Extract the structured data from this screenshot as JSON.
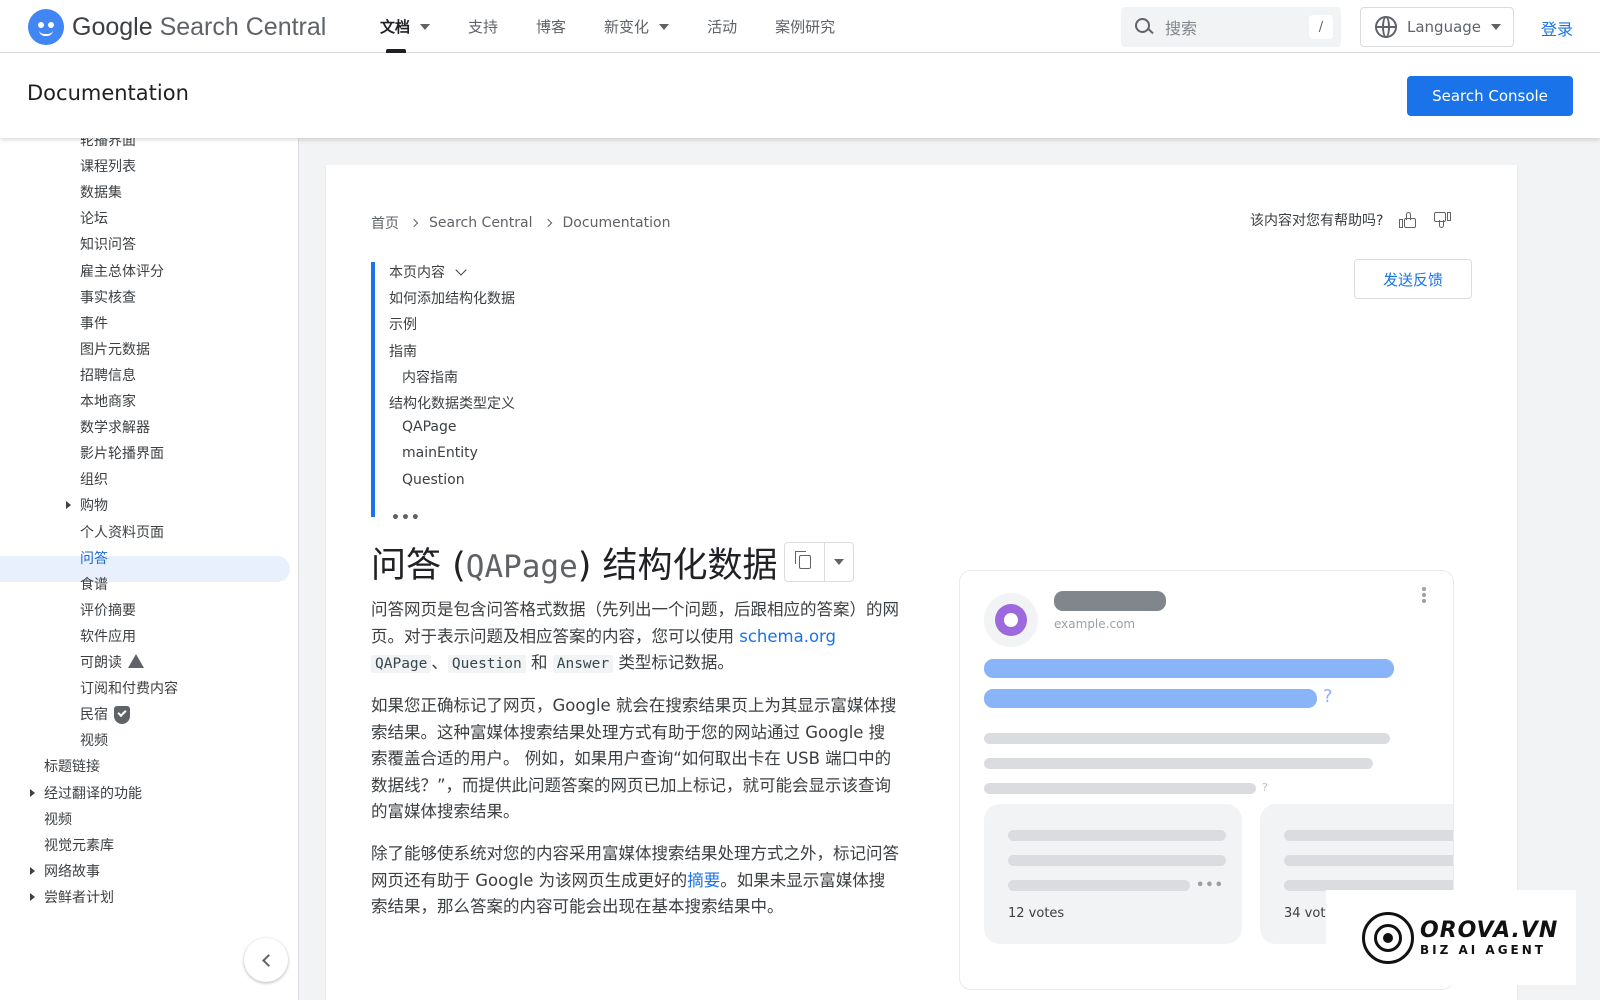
{
  "header": {
    "logo_text_brand": "Google",
    "logo_text_product": "Search Central",
    "nav": [
      {
        "label": "文档",
        "has_dropdown": true,
        "active": true
      },
      {
        "label": "支持",
        "has_dropdown": false
      },
      {
        "label": "博客",
        "has_dropdown": false
      },
      {
        "label": "新变化",
        "has_dropdown": true
      },
      {
        "label": "活动",
        "has_dropdown": false
      },
      {
        "label": "案例研究",
        "has_dropdown": false
      }
    ],
    "search_placeholder": "搜索",
    "search_shortcut": "/",
    "language_label": "Language",
    "login_label": "登录"
  },
  "subheader": {
    "title": "Documentation",
    "search_console_label": "Search Console"
  },
  "sidebar": {
    "items": [
      {
        "label": "轮播界面",
        "level": 2
      },
      {
        "label": "课程列表",
        "level": 2
      },
      {
        "label": "数据集",
        "level": 2
      },
      {
        "label": "论坛",
        "level": 2
      },
      {
        "label": "知识问答",
        "level": 2
      },
      {
        "label": "雇主总体评分",
        "level": 2
      },
      {
        "label": "事实核查",
        "level": 2
      },
      {
        "label": "事件",
        "level": 2
      },
      {
        "label": "图片元数据",
        "level": 2
      },
      {
        "label": "招聘信息",
        "level": 2
      },
      {
        "label": "本地商家",
        "level": 2
      },
      {
        "label": "数学求解器",
        "level": 2
      },
      {
        "label": "影片轮播界面",
        "level": 2
      },
      {
        "label": "组织",
        "level": 2
      },
      {
        "label": "购物",
        "level": 2,
        "expandable": true
      },
      {
        "label": "个人资料页面",
        "level": 2
      },
      {
        "label": "问答",
        "level": 2,
        "active": true
      },
      {
        "label": "食谱",
        "level": 2
      },
      {
        "label": "评价摘要",
        "level": 2
      },
      {
        "label": "软件应用",
        "level": 2
      },
      {
        "label": "可朗读",
        "level": 2,
        "icon": "flask-icon"
      },
      {
        "label": "订阅和付费内容",
        "level": 2
      },
      {
        "label": "民宿",
        "level": 2,
        "icon": "verified-shield-icon"
      },
      {
        "label": "视频",
        "level": 2
      },
      {
        "label": "标题链接",
        "level": 1
      },
      {
        "label": "经过翻译的功能",
        "level": 1,
        "expandable": true
      },
      {
        "label": "视频",
        "level": 1
      },
      {
        "label": "视觉元素库",
        "level": 1
      },
      {
        "label": "网络故事",
        "level": 1,
        "expandable": true
      },
      {
        "label": "尝鲜者计划",
        "level": 1,
        "expandable": true
      }
    ]
  },
  "breadcrumb": [
    "首页",
    "Search Central",
    "Documentation"
  ],
  "helpful_question": "该内容对您有帮助吗?",
  "feedback_label": "发送反馈",
  "toc": {
    "heading": "本页内容",
    "items": [
      {
        "label": "如何添加结构化数据",
        "indent": 0
      },
      {
        "label": "示例",
        "indent": 0
      },
      {
        "label": "指南",
        "indent": 0
      },
      {
        "label": "内容指南",
        "indent": 1
      },
      {
        "label": "结构化数据类型定义",
        "indent": 0
      },
      {
        "label": "QAPage",
        "indent": 1
      },
      {
        "label": "mainEntity",
        "indent": 1
      },
      {
        "label": "Question",
        "indent": 1
      }
    ],
    "more": "•••"
  },
  "article": {
    "title_prefix": "问答 (",
    "title_code": "QAPage",
    "title_suffix": ") 结构化数据",
    "p1_a": "问答网页是包含问答格式数据（先列出一个问题，后跟相应的答案）的网页。对于表示问题及相应答案的内容，您可以使用 ",
    "p1_link": "schema.org",
    "p1_code1": "QAPage",
    "p1_sep1": "、",
    "p1_code2": "Question",
    "p1_sep2": " 和 ",
    "p1_code3": "Answer",
    "p1_b": " 类型标记数据。",
    "p2": "如果您正确标记了网页，Google 就会在搜索结果页上为其显示富媒体搜索结果。这种富媒体搜索结果处理方式有助于您的网站通过 Google 搜索覆盖合适的用户。 例如，如果用户查询“如何取出卡在 USB 端口中的数据线？”，而提供此问题答案的网页已加上标记，就可能会显示该查询的富媒体搜索结果。",
    "p3_a": "除了能够使系统对您的内容采用富媒体搜索结果处理方式之外，标记问答网页还有助于 Google 为该网页生成更好的",
    "p3_link": "摘要",
    "p3_b": "。如果未显示富媒体搜索结果，那么答案的内容可能会出现在基本搜索结果中。"
  },
  "illustration": {
    "site": "example.com",
    "question_mark": "?",
    "cards": [
      {
        "votes": "12 votes",
        "more": "•••"
      },
      {
        "votes": "34 votes"
      }
    ]
  },
  "watermark": {
    "name": "OROVA.VN",
    "tagline": "BIZ AI AGENT"
  },
  "colors": {
    "accent": "#1a73e8",
    "active_bg": "#e8f0fe",
    "illus_blue": "#8ab4f8",
    "illus_purple": "#9c6ade"
  }
}
